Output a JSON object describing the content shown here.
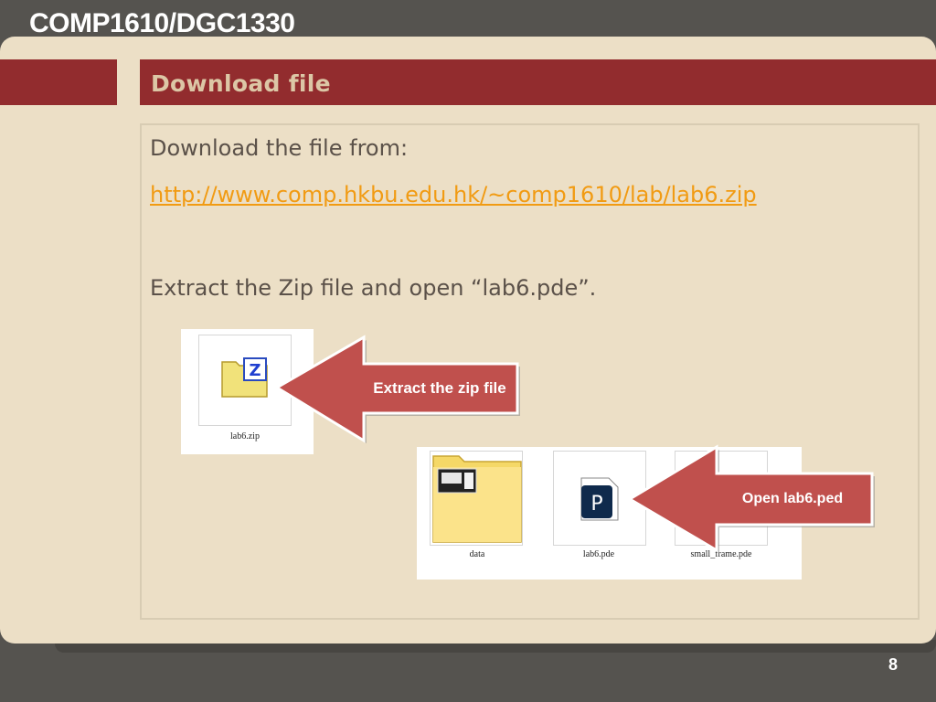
{
  "header": {
    "course": "COMP1610/DGC1330"
  },
  "slide": {
    "title": "Download file",
    "line1": "Download the file from:",
    "link": "http://www.comp.hkbu.edu.hk/~comp1610/lab/lab6.zip",
    "line3": "Extract the Zip file and open “lab6.pde”."
  },
  "screenshot1": {
    "file": "lab6.zip"
  },
  "screenshot2": {
    "files": [
      "data",
      "lab6.pde",
      "small_frame.pde"
    ]
  },
  "callouts": {
    "extract": "Extract the zip file",
    "open": "Open lab6.ped"
  },
  "footer": {
    "page": "8"
  },
  "colors": {
    "accent_red": "#922c2e",
    "link": "#f19b13",
    "card": "#ecdfc6",
    "callout": "#c0504d"
  },
  "icons": {
    "zip": "zip-folder-icon",
    "folder": "data-folder-icon",
    "pde": "processing-file-icon"
  }
}
